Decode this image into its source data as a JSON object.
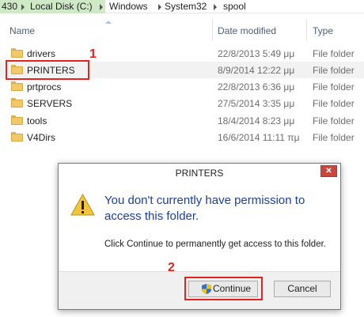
{
  "address_bar": {
    "crumbs": [
      "430",
      "Local Disk (C:)",
      "Windows",
      "System32",
      "spool"
    ]
  },
  "columns": {
    "name": "Name",
    "date_modified": "Date modified",
    "type": "Type"
  },
  "files": [
    {
      "name": "drivers",
      "date": "22/8/2013 5:49 μμ",
      "type": "File folder",
      "icon": "folder-icon"
    },
    {
      "name": "PRINTERS",
      "date": "8/9/2014 12:22 μμ",
      "type": "File folder",
      "icon": "folder-icon"
    },
    {
      "name": "prtprocs",
      "date": "22/8/2013 6:36 μμ",
      "type": "File folder",
      "icon": "folder-icon"
    },
    {
      "name": "SERVERS",
      "date": "27/5/2014 3:35 μμ",
      "type": "File folder",
      "icon": "folder-icon"
    },
    {
      "name": "tools",
      "date": "18/4/2014 8:23 μμ",
      "type": "File folder",
      "icon": "folder-icon"
    },
    {
      "name": "V4Dirs",
      "date": "16/6/2014 11:11 πμ",
      "type": "File folder",
      "icon": "folder-icon"
    }
  ],
  "annotations": {
    "marker1": "1",
    "marker2": "2",
    "color": "#e3231f"
  },
  "dialog": {
    "title": "PRINTERS",
    "close_label": "✕",
    "main_text": "You don't currently have permission to access this folder.",
    "sub_text": "Click Continue to permanently get access to this folder.",
    "continue_label": "Continue",
    "cancel_label": "Cancel",
    "icons": [
      "warning-icon",
      "uac-shield-icon",
      "close-icon"
    ]
  },
  "colors": {
    "address_highlight": "#cfe8c5",
    "header_text": "#4c607a",
    "dialog_main_text": "#1c3f9b",
    "close_button": "#c7463f"
  }
}
